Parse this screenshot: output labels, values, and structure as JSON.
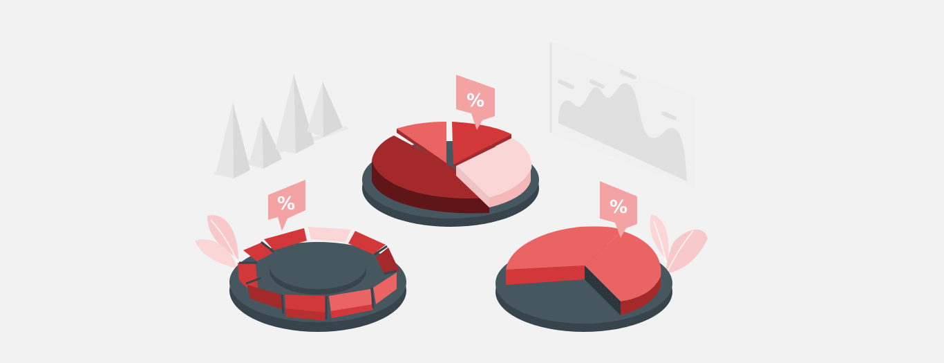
{
  "illustration": {
    "percent_tags": [
      {
        "id": "left-donut",
        "symbol": "%"
      },
      {
        "id": "center-pie",
        "symbol": "%"
      },
      {
        "id": "right-pie",
        "symbol": "%"
      }
    ]
  },
  "palette": {
    "background": "#f2f2f2",
    "base_slate": "#475760",
    "base_slate_dark": "#37444c",
    "red_dark": "#a3292b",
    "red": "#d2383a",
    "red_light": "#ea6464",
    "pink": "#f6a4a6",
    "pink_pale": "#fbd6d7",
    "tag_fill": "#f4a3a5",
    "decor_grey": "#e2e2e2"
  }
}
